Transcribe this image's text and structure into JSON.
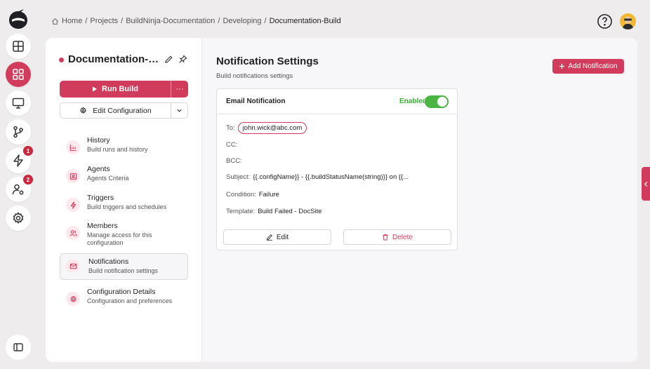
{
  "breadcrumb": {
    "home": "Home",
    "projects": "Projects",
    "project": "BuildNinja-Documentation",
    "folder": "Developing",
    "current": "Documentation-Build",
    "sep": "/"
  },
  "rail": {
    "badges": {
      "builds": "1",
      "users": "2"
    }
  },
  "config": {
    "title": "Documentation-Build",
    "run_build_label": "Run Build",
    "more_label": "···",
    "edit_config_label": "Edit Configuration"
  },
  "nav": [
    {
      "title": "History",
      "subtitle": "Build runs and history"
    },
    {
      "title": "Agents",
      "subtitle": "Agents Criteria"
    },
    {
      "title": "Triggers",
      "subtitle": "Build triggers and schedules"
    },
    {
      "title": "Members",
      "subtitle": "Manage access for this configuration"
    },
    {
      "title": "Notifications",
      "subtitle": "Build notification settings"
    },
    {
      "title": "Configuration Details",
      "subtitle": "Configuration and preferences"
    }
  ],
  "main": {
    "title": "Notification Settings",
    "subtitle": "Build notifications settings",
    "add_label": "Add Notification"
  },
  "card": {
    "title": "Email Notification",
    "status": "Enabled",
    "enabled": true,
    "to_label": "To:",
    "to_value": "john.wick@abc.com",
    "cc_label": "CC:",
    "bcc_label": "BCC:",
    "subject_label": "Subject:",
    "subject_value": "{{.configName}} - {{.buildStatusName(string)}} on {{...",
    "condition_label": "Condition:",
    "condition_value": "Failure",
    "template_label": "Template:",
    "template_value": "Build Failed - DocSite",
    "edit_label": "Edit",
    "delete_label": "Delete"
  },
  "colors": {
    "accent": "#d23c5c",
    "enabled": "#4bb543",
    "badge": "#c7293f"
  }
}
